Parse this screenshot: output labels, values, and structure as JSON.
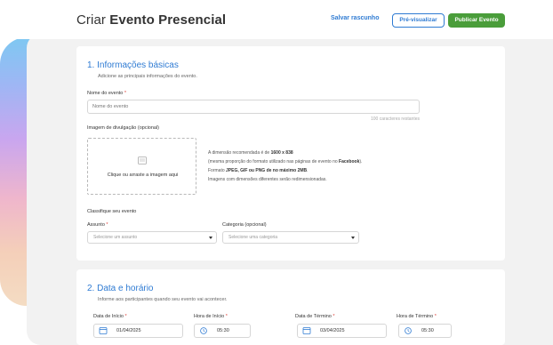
{
  "header": {
    "title_prefix": "Criar ",
    "title_bold": "Evento Presencial",
    "save_draft": "Salvar rascunho",
    "preview": "Pré-visualizar",
    "publish": "Publicar Evento"
  },
  "colors": {
    "accent": "#2f7bd3",
    "publish": "#4a9d3a",
    "required": "#e0413a"
  },
  "section1": {
    "title": "1. Informações básicas",
    "subtitle": "Adicione as principais informações do evento.",
    "name_label": "Nome do evento",
    "name_placeholder": "Nome do evento",
    "name_counter": "100 caracteres restantes",
    "image_label": "Imagem de divulgação (opcional)",
    "drop_text": "Clique ou arraste a imagem aqui",
    "info": {
      "line1_prefix": "A dimensão recomendada é de ",
      "line1_bold": "1600 x 838",
      "line2_prefix": "(mesma proporção do formato utilizado nas páginas de evento no ",
      "line2_bold": "Facebook",
      "line2_suffix": ").",
      "line3_prefix": "Formato ",
      "line3_bold": "JPEG, GIF ou PNG de no máximo 2MB",
      "line3_suffix": ".",
      "line4": "Imagens com dimensões diferentes serão redimensionadas."
    },
    "classify_label": "Classifique seu evento",
    "subject_label": "Assunto",
    "subject_placeholder": "Selecione um assunto",
    "category_label": "Categoria (opcional)",
    "category_placeholder": "Selecione uma categoria"
  },
  "section2": {
    "title": "2. Data e horário",
    "subtitle": "Informe aos participantes quando seu evento vai acontecer.",
    "start_date_label": "Data de Início",
    "start_date_value": "01/04/2025",
    "start_time_label": "Hora de Início",
    "start_time_value": "05:30",
    "end_date_label": "Data de Término",
    "end_date_value": "03/04/2025",
    "end_time_label": "Hora de Término",
    "end_time_value": "05:30"
  },
  "required_mark": "*"
}
